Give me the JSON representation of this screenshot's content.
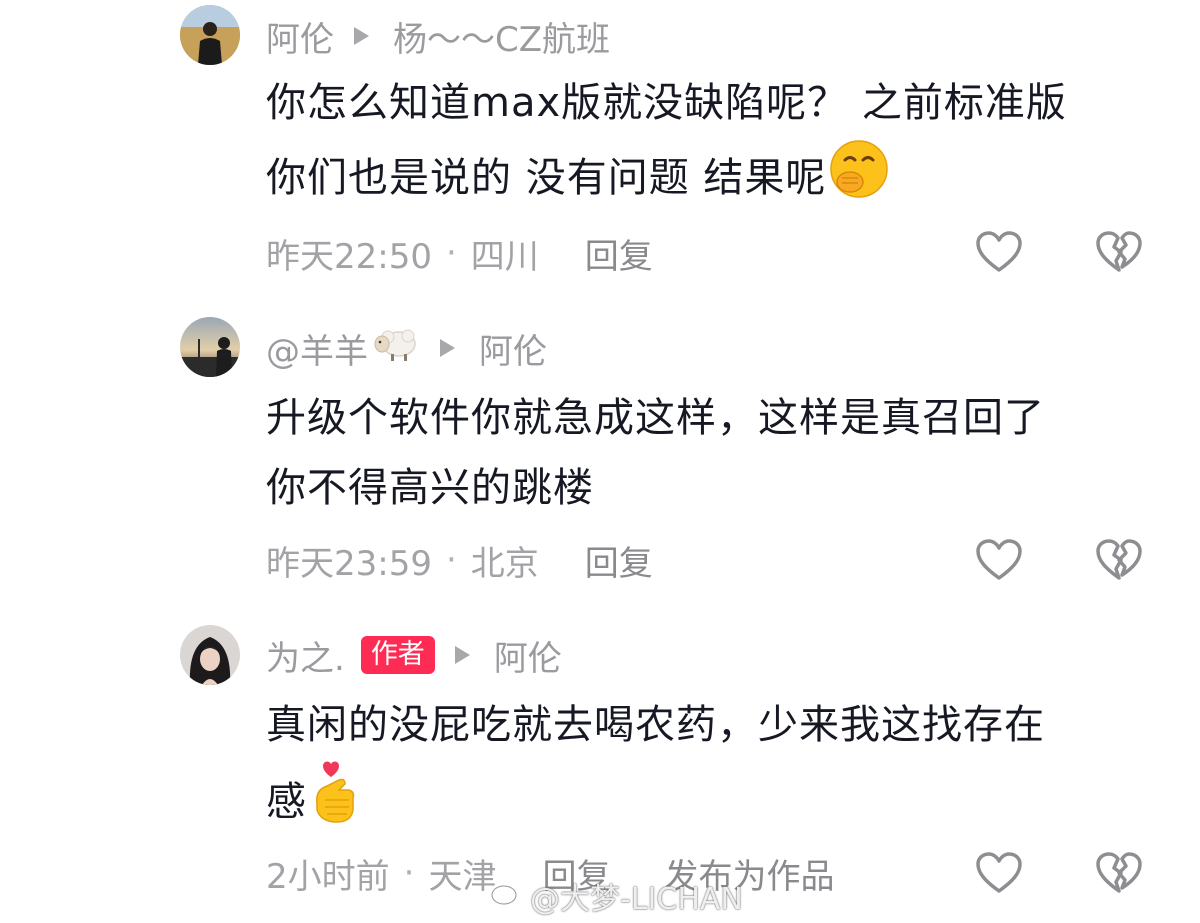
{
  "comments": [
    {
      "username": "阿伦",
      "reply_to": "杨～～CZ航班",
      "text_lines": [
        "你怎么知道max版就没缺陷呢？ 之前标准版",
        "你们也是说的 没有问题  结果呢"
      ],
      "emoji": "hand-over-mouth-emoji",
      "time": "昨天22:50",
      "location": "四川",
      "reply_label": "回复",
      "avatar": "avatar-man-in-field"
    },
    {
      "username": "@羊羊",
      "username_emoji": "sheep-emoji",
      "reply_to": "阿伦",
      "text_lines": [
        "升级个软件你就急成这样，这样是真召回了",
        "你不得高兴的跳楼"
      ],
      "time": "昨天23:59",
      "location": "北京",
      "reply_label": "回复",
      "avatar": "avatar-silhouette-sunset"
    },
    {
      "username": "为之.",
      "badge": "作者",
      "reply_to": "阿伦",
      "text_lines": [
        "真闲的没屁吃就去喝农药，少来我这找存在",
        "感"
      ],
      "emoji": "finger-heart-emoji",
      "time": "2小时前",
      "location": "天津",
      "reply_label": "回复",
      "publish_label": "发布为作品",
      "avatar": "avatar-dark-hair-person"
    }
  ],
  "icons": {
    "like": "heart-outline-icon",
    "dislike": "broken-heart-icon"
  },
  "watermark": {
    "text": "@大梦-LICHAN",
    "logo": "weibo-logo"
  },
  "colors": {
    "badge": "#fe2c55",
    "muted": "#9b9b9f",
    "text": "#161823"
  }
}
